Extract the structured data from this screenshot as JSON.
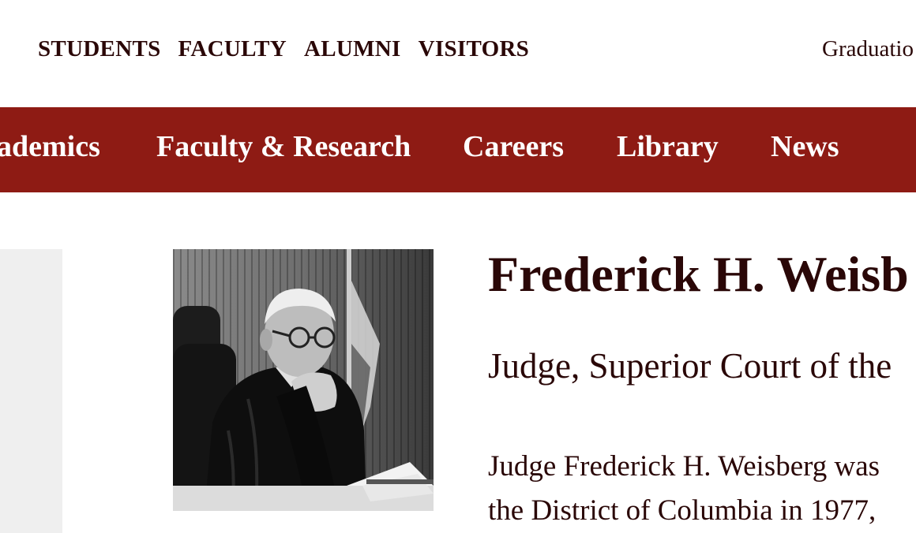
{
  "audience_nav": {
    "items": [
      "STUDENTS",
      "FACULTY",
      "ALUMNI",
      "VISITORS"
    ]
  },
  "utility": {
    "right_link": "Graduatio"
  },
  "main_nav": {
    "items": [
      "ademics",
      "Faculty & Research",
      "Careers",
      "Library",
      "News"
    ]
  },
  "profile": {
    "photo_alt": "Portrait of Judge Frederick H. Weisberg",
    "name": "Frederick H. Weisb",
    "title": "Judge, Superior Court of the",
    "bio_line_1": "Judge Frederick H. Weisberg was",
    "bio_line_2": "the District of Columbia in 1977,"
  },
  "colors": {
    "brand": "#8e1b14",
    "text": "#2a0707",
    "side_panel": "#efefef"
  }
}
